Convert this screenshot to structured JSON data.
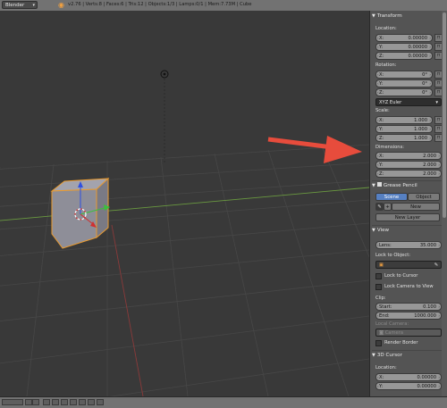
{
  "header": {
    "render_engine": "Blender Render",
    "stats": "v2.76 | Verts:8 | Faces:6 | Tris:12 | Objects:1/3 | Lamps:0/1 | Mem:7.73M | Cube"
  },
  "transform": {
    "title": "Transform",
    "location_label": "Location:",
    "location": [
      {
        "axis": "X:",
        "value": "0.00000"
      },
      {
        "axis": "Y:",
        "value": "0.00000"
      },
      {
        "axis": "Z:",
        "value": "0.00000"
      }
    ],
    "rotation_label": "Rotation:",
    "rotation": [
      {
        "axis": "X:",
        "value": "0°"
      },
      {
        "axis": "Y:",
        "value": "0°"
      },
      {
        "axis": "Z:",
        "value": "0°"
      }
    ],
    "rotation_mode": "XYZ Euler",
    "scale_label": "Scale:",
    "scale": [
      {
        "axis": "X:",
        "value": "1.000"
      },
      {
        "axis": "Y:",
        "value": "1.000"
      },
      {
        "axis": "Z:",
        "value": "1.000"
      }
    ],
    "dimensions_label": "Dimensions:",
    "dimensions": [
      {
        "axis": "X:",
        "value": "2.000"
      },
      {
        "axis": "Y:",
        "value": "2.000"
      },
      {
        "axis": "Z:",
        "value": "2.000"
      }
    ]
  },
  "grease_pencil": {
    "title": "Grease Pencil",
    "tab_scene": "Scene",
    "tab_object": "Object",
    "new_label": "New",
    "new_layer_label": "New Layer"
  },
  "view": {
    "title": "View",
    "lens_label": "Lens:",
    "lens_value": "35.000",
    "lock_to_object_label": "Lock to Object:",
    "lock_to_cursor": "Lock to Cursor",
    "lock_camera_to_view": "Lock Camera to View",
    "clip_label": "Clip:",
    "clip_start_label": "Start:",
    "clip_start": "0.100",
    "clip_end_label": "End:",
    "clip_end": "1000.000",
    "local_camera_label": "Local Camera:",
    "camera_placeholder": "Camera",
    "render_border": "Render Border"
  },
  "cursor3d": {
    "title": "3D Cursor",
    "location_label": "Location:",
    "location": [
      {
        "axis": "X:",
        "value": "0.00000"
      },
      {
        "axis": "Y:",
        "value": "0.00000"
      }
    ]
  },
  "colors": {
    "arrow": "#e74c3c",
    "accent": "#5680c2"
  }
}
